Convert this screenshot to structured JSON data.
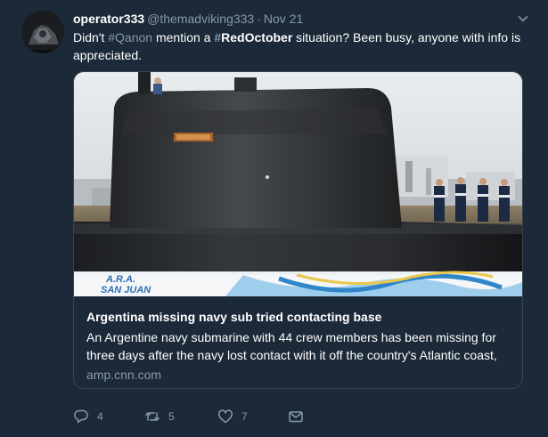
{
  "tweet": {
    "display_name": "operator333",
    "handle": "@themadviking333",
    "separator": "·",
    "timestamp": "Nov 21",
    "text": {
      "part1": "Didn't ",
      "hashtag1_symbol": "#",
      "hashtag1_word": "Qanon",
      "part2": " mention a ",
      "hashtag2_symbol": "#",
      "hashtag2_word": "RedOctober",
      "part3": " situation? Been busy, anyone with info is appreciated."
    }
  },
  "card": {
    "hull_label": "A.R.A. SAN JUAN",
    "plate_label": "SAN JUAN",
    "title": "Argentina missing navy sub tried contacting base",
    "description": "An Argentine navy submarine with 44 crew members has been missing for three days after the navy lost contact with it off the country's Atlantic coast,",
    "domain": "amp.cnn.com"
  },
  "actions": {
    "reply_count": "4",
    "retweet_count": "5",
    "like_count": "7"
  },
  "icons": {
    "avatar": "avatar-icon",
    "caret": "chevron-down-icon",
    "reply": "reply-icon",
    "retweet": "retweet-icon",
    "like": "heart-icon",
    "dm": "envelope-icon"
  },
  "colors": {
    "background": "#1c2938",
    "secondary_text": "#8899a6",
    "border": "#38444d"
  }
}
